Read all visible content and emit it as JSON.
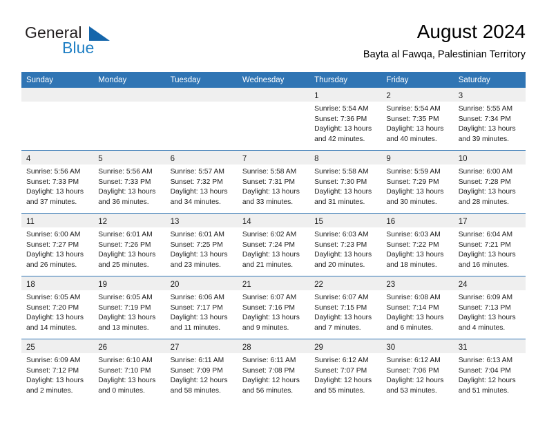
{
  "brand": {
    "name_part1": "General",
    "name_part2": "Blue",
    "flag_icon": "triangle-flag-icon"
  },
  "header": {
    "title": "August 2024",
    "location": "Bayta al Fawqa, Palestinian Territory"
  },
  "colors": {
    "header_blue": "#3075b4",
    "brand_blue": "#1f7fc4",
    "day_band_gray": "#efefef",
    "row_divider": "#3075b4"
  },
  "weekday_headers": [
    "Sunday",
    "Monday",
    "Tuesday",
    "Wednesday",
    "Thursday",
    "Friday",
    "Saturday"
  ],
  "weeks": [
    [
      {
        "day": "",
        "lines": []
      },
      {
        "day": "",
        "lines": []
      },
      {
        "day": "",
        "lines": []
      },
      {
        "day": "",
        "lines": []
      },
      {
        "day": "1",
        "lines": [
          "Sunrise: 5:54 AM",
          "Sunset: 7:36 PM",
          "Daylight: 13 hours",
          "and 42 minutes."
        ]
      },
      {
        "day": "2",
        "lines": [
          "Sunrise: 5:54 AM",
          "Sunset: 7:35 PM",
          "Daylight: 13 hours",
          "and 40 minutes."
        ]
      },
      {
        "day": "3",
        "lines": [
          "Sunrise: 5:55 AM",
          "Sunset: 7:34 PM",
          "Daylight: 13 hours",
          "and 39 minutes."
        ]
      }
    ],
    [
      {
        "day": "4",
        "lines": [
          "Sunrise: 5:56 AM",
          "Sunset: 7:33 PM",
          "Daylight: 13 hours",
          "and 37 minutes."
        ]
      },
      {
        "day": "5",
        "lines": [
          "Sunrise: 5:56 AM",
          "Sunset: 7:33 PM",
          "Daylight: 13 hours",
          "and 36 minutes."
        ]
      },
      {
        "day": "6",
        "lines": [
          "Sunrise: 5:57 AM",
          "Sunset: 7:32 PM",
          "Daylight: 13 hours",
          "and 34 minutes."
        ]
      },
      {
        "day": "7",
        "lines": [
          "Sunrise: 5:58 AM",
          "Sunset: 7:31 PM",
          "Daylight: 13 hours",
          "and 33 minutes."
        ]
      },
      {
        "day": "8",
        "lines": [
          "Sunrise: 5:58 AM",
          "Sunset: 7:30 PM",
          "Daylight: 13 hours",
          "and 31 minutes."
        ]
      },
      {
        "day": "9",
        "lines": [
          "Sunrise: 5:59 AM",
          "Sunset: 7:29 PM",
          "Daylight: 13 hours",
          "and 30 minutes."
        ]
      },
      {
        "day": "10",
        "lines": [
          "Sunrise: 6:00 AM",
          "Sunset: 7:28 PM",
          "Daylight: 13 hours",
          "and 28 minutes."
        ]
      }
    ],
    [
      {
        "day": "11",
        "lines": [
          "Sunrise: 6:00 AM",
          "Sunset: 7:27 PM",
          "Daylight: 13 hours",
          "and 26 minutes."
        ]
      },
      {
        "day": "12",
        "lines": [
          "Sunrise: 6:01 AM",
          "Sunset: 7:26 PM",
          "Daylight: 13 hours",
          "and 25 minutes."
        ]
      },
      {
        "day": "13",
        "lines": [
          "Sunrise: 6:01 AM",
          "Sunset: 7:25 PM",
          "Daylight: 13 hours",
          "and 23 minutes."
        ]
      },
      {
        "day": "14",
        "lines": [
          "Sunrise: 6:02 AM",
          "Sunset: 7:24 PM",
          "Daylight: 13 hours",
          "and 21 minutes."
        ]
      },
      {
        "day": "15",
        "lines": [
          "Sunrise: 6:03 AM",
          "Sunset: 7:23 PM",
          "Daylight: 13 hours",
          "and 20 minutes."
        ]
      },
      {
        "day": "16",
        "lines": [
          "Sunrise: 6:03 AM",
          "Sunset: 7:22 PM",
          "Daylight: 13 hours",
          "and 18 minutes."
        ]
      },
      {
        "day": "17",
        "lines": [
          "Sunrise: 6:04 AM",
          "Sunset: 7:21 PM",
          "Daylight: 13 hours",
          "and 16 minutes."
        ]
      }
    ],
    [
      {
        "day": "18",
        "lines": [
          "Sunrise: 6:05 AM",
          "Sunset: 7:20 PM",
          "Daylight: 13 hours",
          "and 14 minutes."
        ]
      },
      {
        "day": "19",
        "lines": [
          "Sunrise: 6:05 AM",
          "Sunset: 7:19 PM",
          "Daylight: 13 hours",
          "and 13 minutes."
        ]
      },
      {
        "day": "20",
        "lines": [
          "Sunrise: 6:06 AM",
          "Sunset: 7:17 PM",
          "Daylight: 13 hours",
          "and 11 minutes."
        ]
      },
      {
        "day": "21",
        "lines": [
          "Sunrise: 6:07 AM",
          "Sunset: 7:16 PM",
          "Daylight: 13 hours",
          "and 9 minutes."
        ]
      },
      {
        "day": "22",
        "lines": [
          "Sunrise: 6:07 AM",
          "Sunset: 7:15 PM",
          "Daylight: 13 hours",
          "and 7 minutes."
        ]
      },
      {
        "day": "23",
        "lines": [
          "Sunrise: 6:08 AM",
          "Sunset: 7:14 PM",
          "Daylight: 13 hours",
          "and 6 minutes."
        ]
      },
      {
        "day": "24",
        "lines": [
          "Sunrise: 6:09 AM",
          "Sunset: 7:13 PM",
          "Daylight: 13 hours",
          "and 4 minutes."
        ]
      }
    ],
    [
      {
        "day": "25",
        "lines": [
          "Sunrise: 6:09 AM",
          "Sunset: 7:12 PM",
          "Daylight: 13 hours",
          "and 2 minutes."
        ]
      },
      {
        "day": "26",
        "lines": [
          "Sunrise: 6:10 AM",
          "Sunset: 7:10 PM",
          "Daylight: 13 hours",
          "and 0 minutes."
        ]
      },
      {
        "day": "27",
        "lines": [
          "Sunrise: 6:11 AM",
          "Sunset: 7:09 PM",
          "Daylight: 12 hours",
          "and 58 minutes."
        ]
      },
      {
        "day": "28",
        "lines": [
          "Sunrise: 6:11 AM",
          "Sunset: 7:08 PM",
          "Daylight: 12 hours",
          "and 56 minutes."
        ]
      },
      {
        "day": "29",
        "lines": [
          "Sunrise: 6:12 AM",
          "Sunset: 7:07 PM",
          "Daylight: 12 hours",
          "and 55 minutes."
        ]
      },
      {
        "day": "30",
        "lines": [
          "Sunrise: 6:12 AM",
          "Sunset: 7:06 PM",
          "Daylight: 12 hours",
          "and 53 minutes."
        ]
      },
      {
        "day": "31",
        "lines": [
          "Sunrise: 6:13 AM",
          "Sunset: 7:04 PM",
          "Daylight: 12 hours",
          "and 51 minutes."
        ]
      }
    ]
  ]
}
